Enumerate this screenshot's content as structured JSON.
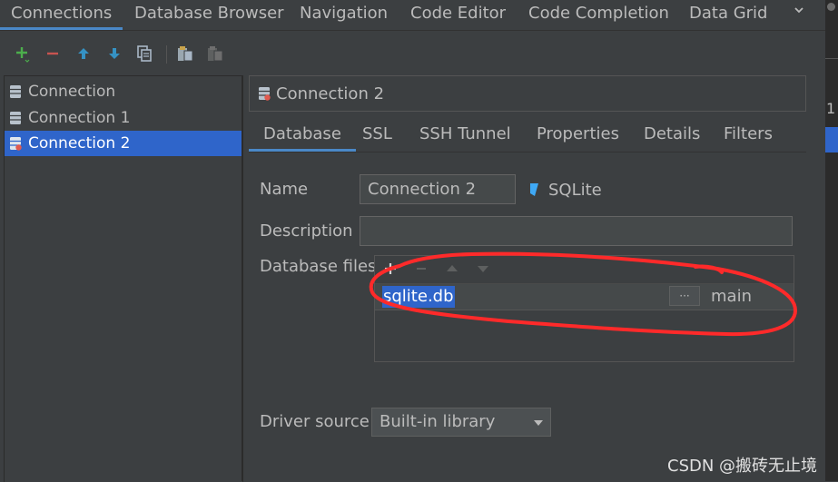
{
  "top_tabs": [
    {
      "label": "Connections"
    },
    {
      "label": "Database Browser"
    },
    {
      "label": "Navigation"
    },
    {
      "label": "Code Editor"
    },
    {
      "label": "Code Completion"
    },
    {
      "label": "Data Grid"
    }
  ],
  "right_strip": {
    "num": "1"
  },
  "connections": [
    {
      "label": "Connection"
    },
    {
      "label": "Connection 1"
    },
    {
      "label": "Connection 2"
    }
  ],
  "selected_connection": "Connection 2",
  "header": {
    "title": "Connection 2"
  },
  "sub_tabs": [
    {
      "label": "Database"
    },
    {
      "label": "SSL"
    },
    {
      "label": "SSH Tunnel"
    },
    {
      "label": "Properties"
    },
    {
      "label": "Details"
    },
    {
      "label": "Filters"
    }
  ],
  "form": {
    "name_label": "Name",
    "name_value": "Connection 2",
    "db_type": "SQLite",
    "description_label": "Description",
    "description_value": "",
    "files_label": "Database files",
    "files": [
      {
        "path": "sqlite.db",
        "browse": "···",
        "schema": "main"
      }
    ],
    "driver_label": "Driver source",
    "driver_value": "Built-in library"
  },
  "colors": {
    "background": "#3c3f41",
    "selection": "#2f65ca",
    "tab_underline": "#4a88c7",
    "add": "#4cae4c",
    "remove": "#c75450",
    "move": "#3592c4",
    "annotation": "#ff2a2a"
  },
  "watermark": "CSDN @搬砖无止境"
}
